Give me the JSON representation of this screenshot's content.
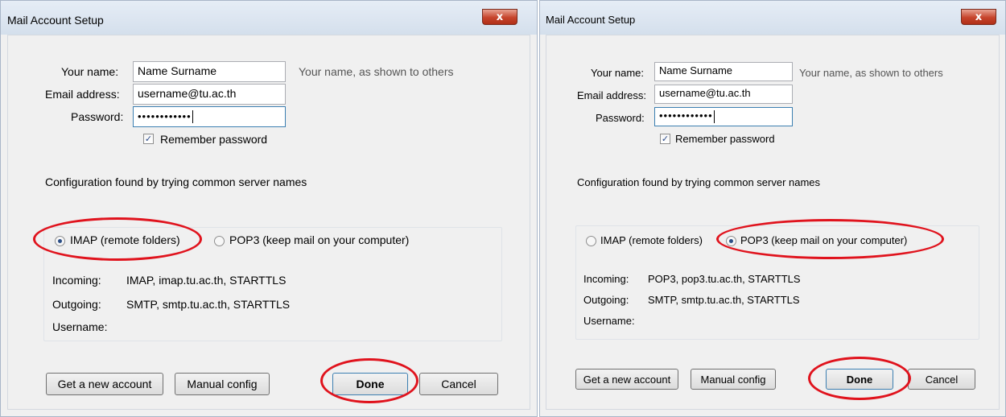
{
  "left": {
    "title": "Mail Account Setup",
    "close": "x",
    "your_name_label": "Your name:",
    "your_name_value": "Name Surname",
    "your_name_hint": "Your name, as shown to others",
    "email_label": "Email address:",
    "email_value": "username@tu.ac.th",
    "password_label": "Password:",
    "password_value": "••••••••••••",
    "remember_label": "Remember password",
    "config_text": "Configuration found by trying common server names",
    "imap_label": "IMAP (remote folders)",
    "pop3_label": "POP3 (keep mail on your computer)",
    "incoming_label": "Incoming:",
    "incoming_value": "IMAP, imap.tu.ac.th, STARTTLS",
    "outgoing_label": "Outgoing:",
    "outgoing_value": "SMTP, smtp.tu.ac.th, STARTTLS",
    "username_label": "Username:",
    "get_new_account": "Get a new account",
    "manual_config": "Manual config",
    "done": "Done",
    "cancel": "Cancel"
  },
  "right": {
    "title": "Mail Account Setup",
    "close": "x",
    "your_name_label": "Your name:",
    "your_name_value": "Name Surname",
    "your_name_hint": "Your name, as shown to others",
    "email_label": "Email address:",
    "email_value": "username@tu.ac.th",
    "password_label": "Password:",
    "password_value": "••••••••••••",
    "remember_label": "Remember password",
    "config_text": "Configuration found by trying common server names",
    "imap_label": "IMAP (remote folders)",
    "pop3_label": "POP3 (keep mail on your computer)",
    "incoming_label": "Incoming:",
    "incoming_value": "POP3, pop3.tu.ac.th, STARTTLS",
    "outgoing_label": "Outgoing:",
    "outgoing_value": "SMTP, smtp.tu.ac.th, STARTTLS",
    "username_label": "Username:",
    "get_new_account": "Get a new account",
    "manual_config": "Manual config",
    "done": "Done",
    "cancel": "Cancel"
  },
  "colors": {
    "highlight_oval": "#e0131d",
    "close_button": "#c6442c",
    "radio_selected": "#2b4e86"
  },
  "icons": {
    "close": "close-icon",
    "checkbox": "checkmark-icon",
    "radio": "radio-icon"
  },
  "state": {
    "left_selected_protocol": "IMAP",
    "right_selected_protocol": "POP3",
    "remember_password_checked": true
  }
}
